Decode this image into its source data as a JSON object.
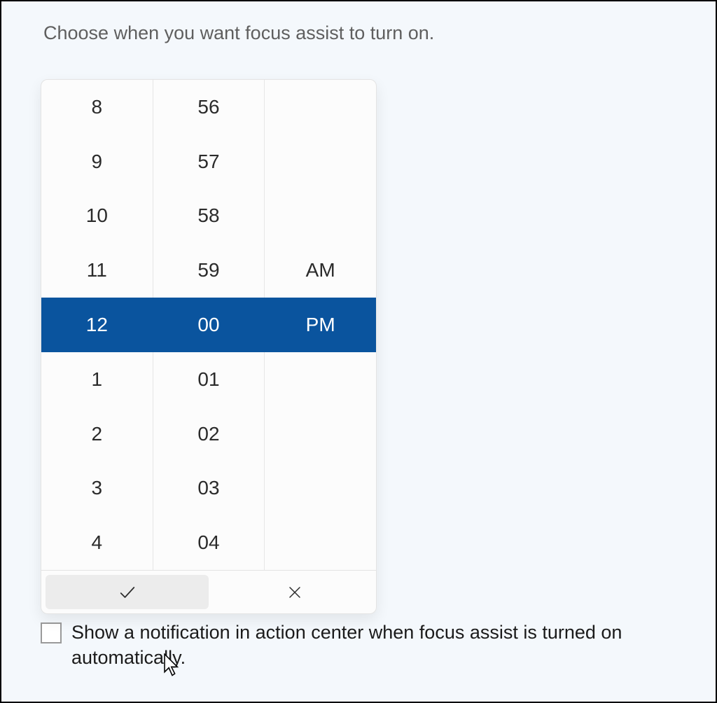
{
  "header": {
    "description": "Choose when you want focus assist to turn on."
  },
  "time_picker": {
    "hours": [
      "8",
      "9",
      "10",
      "11",
      "12",
      "1",
      "2",
      "3",
      "4"
    ],
    "minutes": [
      "56",
      "57",
      "58",
      "59",
      "00",
      "01",
      "02",
      "03",
      "04"
    ],
    "period": [
      "",
      "",
      "",
      "AM",
      "PM",
      "",
      "",
      "",
      ""
    ],
    "selected_index": 4,
    "selected_hour": "12",
    "selected_minute": "00",
    "selected_period": "PM"
  },
  "checkbox": {
    "label": "Show a notification in action center when focus assist is turned on automatically.",
    "checked": false
  },
  "icons": {
    "check": "check-icon",
    "close": "close-icon"
  }
}
